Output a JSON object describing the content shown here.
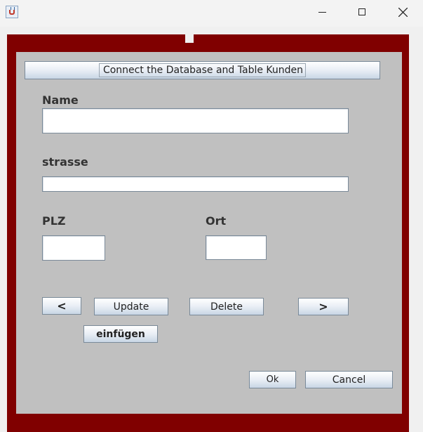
{
  "window": {
    "icon": "java-coffee-cup-icon"
  },
  "form": {
    "connect_button": "Connect the Database and Table Kunden",
    "labels": {
      "name": "Name",
      "strasse": "strasse",
      "plz": "PLZ",
      "ort": "Ort"
    },
    "fields": {
      "name": "",
      "strasse": "",
      "plz": "",
      "ort": ""
    },
    "buttons": {
      "prev": "<",
      "update": "Update",
      "delete": "Delete",
      "next": ">",
      "insert": "einfügen",
      "ok": "Ok",
      "cancel": "Cancel"
    }
  },
  "colors": {
    "frame": "#800000",
    "panel": "#c0c0c0"
  }
}
